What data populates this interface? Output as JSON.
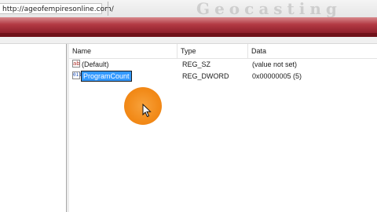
{
  "browser": {
    "url": "http://ageofempiresonline.com/",
    "watermark": "Geocasting"
  },
  "list": {
    "columns": [
      "Name",
      "Type",
      "Data"
    ],
    "rows": [
      {
        "icon": "string-value-icon",
        "name": "(Default)",
        "type": "REG_SZ",
        "data": "(value not set)"
      },
      {
        "icon": "dword-value-icon",
        "name": "ProgramCount",
        "type": "REG_DWORD",
        "data": "0x00000005 (5)",
        "editing": true
      }
    ]
  },
  "colors": {
    "banner": "#b33a44",
    "selection": "#3399ff",
    "cursor_halo": "#f28a18"
  }
}
